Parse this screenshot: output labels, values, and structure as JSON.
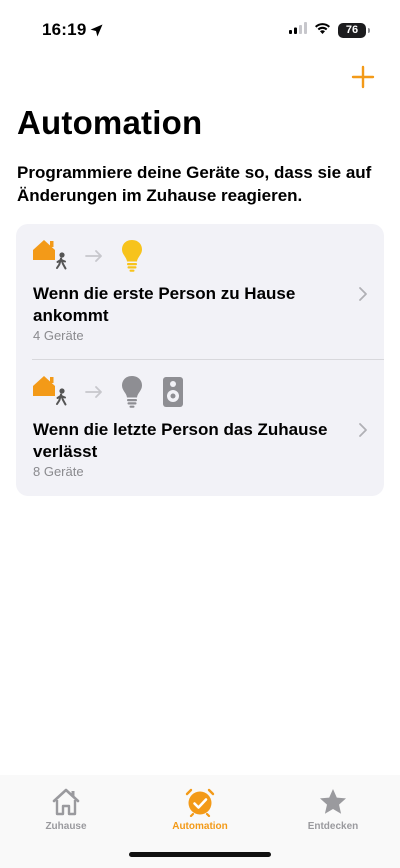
{
  "status_bar": {
    "time": "16:19",
    "battery": "76"
  },
  "header": {
    "add_icon": "plus-icon",
    "title": "Automation",
    "subtitle": "Programmiere deine Geräte so, dass sie auf Änderungen im Zuhause reagieren."
  },
  "automations": [
    {
      "title": "Wenn die erste Person zu Hause ankommt",
      "subtitle": "4 Geräte",
      "trigger_icon": "person-arrives-home-icon",
      "device_icons": [
        "lightbulb-on-icon"
      ]
    },
    {
      "title": "Wenn die letzte Person das Zuhause verlässt",
      "subtitle": "8 Geräte",
      "trigger_icon": "person-leaves-home-icon",
      "device_icons": [
        "lightbulb-off-icon",
        "speaker-icon"
      ]
    }
  ],
  "tab_bar": {
    "tabs": [
      {
        "label": "Zuhause",
        "icon": "house-icon",
        "active": false
      },
      {
        "label": "Automation",
        "icon": "clock-check-icon",
        "active": true
      },
      {
        "label": "Entdecken",
        "icon": "star-icon",
        "active": false
      }
    ]
  },
  "colors": {
    "accent": "#f39a18",
    "card_background": "#f2f2f7",
    "secondary_text": "#8a8a8e",
    "inactive_tab": "#9a9a9e",
    "bulb_on": "#f7c31c"
  }
}
